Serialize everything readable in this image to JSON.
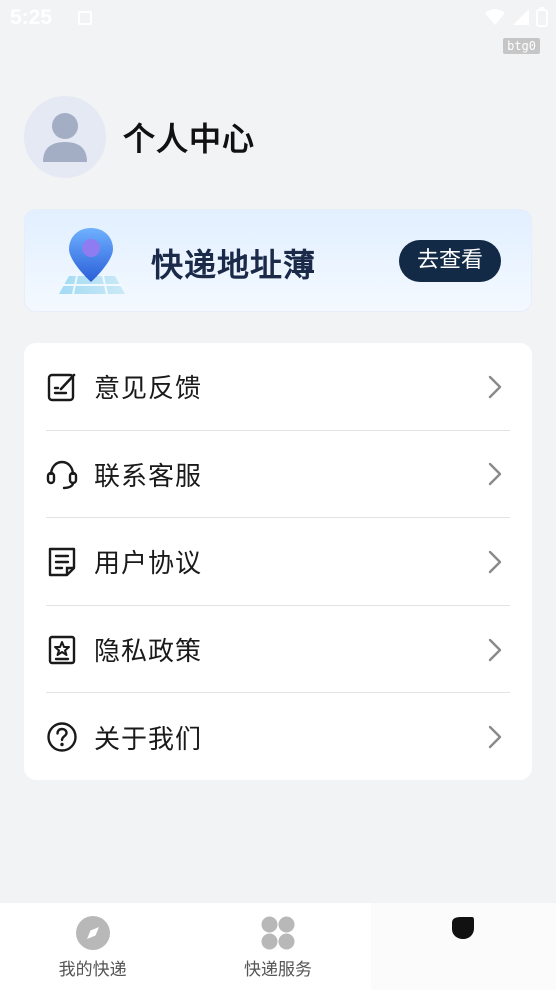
{
  "status_bar": {
    "time": "5:25",
    "debug_tag": "btg0"
  },
  "profile": {
    "title": "个人中心"
  },
  "banner": {
    "title": "快递地址薄",
    "button_label": "去查看"
  },
  "menu": {
    "items": [
      {
        "label": "意见反馈",
        "icon": "feedback-edit-icon"
      },
      {
        "label": "联系客服",
        "icon": "headset-icon"
      },
      {
        "label": "用户协议",
        "icon": "document-icon"
      },
      {
        "label": "隐私政策",
        "icon": "privacy-star-icon"
      },
      {
        "label": "关于我们",
        "icon": "question-circle-icon"
      }
    ]
  },
  "tabs": [
    {
      "label": "我的快递",
      "icon": "compass-icon"
    },
    {
      "label": "快递服务",
      "icon": "grid-icon"
    },
    {
      "label": "",
      "icon": "profile-leaf-icon",
      "active": true
    }
  ],
  "colors": {
    "accent_dark": "#132a46",
    "background": "#f2f3f5",
    "card": "#ffffff"
  }
}
